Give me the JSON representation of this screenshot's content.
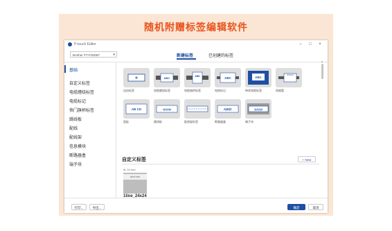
{
  "banner": {
    "title": "随机附赠标签编辑软件"
  },
  "window": {
    "title": "P-touch Editor",
    "controls": [
      "–",
      "□",
      "×"
    ]
  },
  "printer": {
    "value": "Brother PT-P300BT"
  },
  "tabs": [
    {
      "label": "新建标签",
      "active": true
    },
    {
      "label": "已创建的标签",
      "active": false
    }
  ],
  "sidebar": {
    "items": [
      {
        "label": "基础",
        "active": true
      },
      {
        "label": "自定义标签"
      },
      {
        "label": "电缆缠绕标签"
      },
      {
        "label": "电缆标记"
      },
      {
        "label": "快门旗帜标签"
      },
      {
        "label": "跳线板"
      },
      {
        "label": "配线"
      },
      {
        "label": "配线架"
      },
      {
        "label": "信息模块"
      },
      {
        "label": "断路器盒"
      },
      {
        "label": "端子块"
      }
    ]
  },
  "templates": [
    {
      "label": "自由标签",
      "art": "+"
    },
    {
      "label": "电缆缠绕标签",
      "art": "ABC"
    },
    {
      "label": "电缆旗帜标签",
      "art": "ABD"
    },
    {
      "label": "电缆标记",
      "art": "ABC"
    },
    {
      "label": "带状电缆标签",
      "art": "ABC"
    },
    {
      "label": "热缩管",
      "art": ""
    },
    {
      "label": "面板",
      "art": "AB CD"
    },
    {
      "label": "跳线板",
      "art": "1|2|3|4"
    },
    {
      "label": "配线架标签",
      "art": ""
    },
    {
      "label": "断路器盒",
      "art": "A|B|C"
    },
    {
      "label": "端子块",
      "art": "1|2|3|4"
    }
  ],
  "custom_section": {
    "title": "自定义标签",
    "new_button": "+ New",
    "size": "9L 24 mm",
    "thumb_text": "abcd star",
    "name": "1line_24x24"
  },
  "footer": {
    "left_buttons": [
      "打印...",
      "导出..."
    ],
    "ok": "确定",
    "cancel": "取消"
  },
  "colors": {
    "accent": "#1f4fa3",
    "banner_text": "#e8531e",
    "banner_bg": "#fbe6d5"
  }
}
